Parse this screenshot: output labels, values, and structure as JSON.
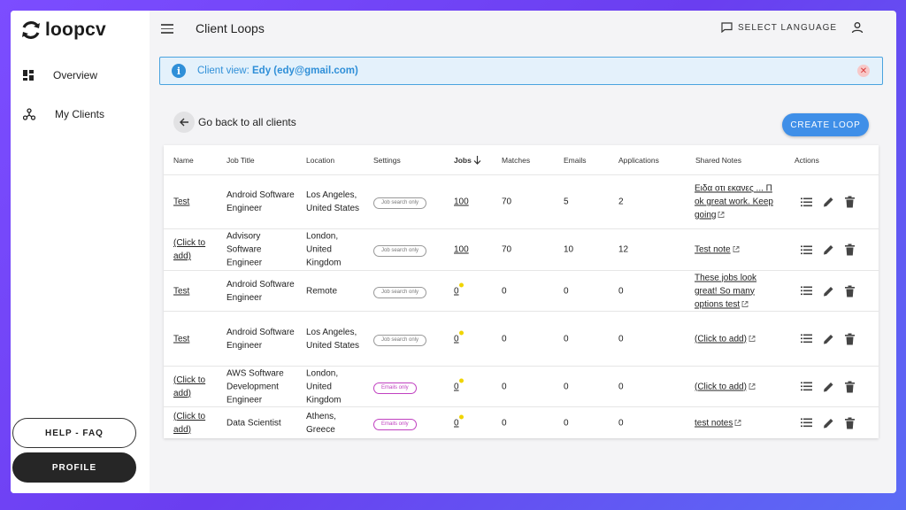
{
  "app": {
    "logo_text": "loopcv"
  },
  "sidebar": {
    "items": [
      {
        "label": "Overview",
        "icon": "dashboard-icon"
      },
      {
        "label": "My Clients",
        "icon": "hub-icon"
      }
    ],
    "help_label": "HELP - FAQ",
    "profile_label": "PROFILE"
  },
  "header": {
    "title": "Client Loops",
    "language_label": "SELECT LANGUAGE"
  },
  "banner": {
    "prefix": "Client view:",
    "client": "Edy (edy@gmail.com)"
  },
  "back_label": "Go back to all clients",
  "create_label": "CREATE LOOP",
  "table": {
    "headers": {
      "name": "Name",
      "job_title": "Job Title",
      "location": "Location",
      "settings": "Settings",
      "jobs": "Jobs",
      "matches": "Matches",
      "emails": "Emails",
      "applications": "Applications",
      "shared_notes": "Shared Notes",
      "actions": "Actions"
    },
    "rows": [
      {
        "name": "Test",
        "job_title": "Android Software Engineer",
        "location": "Los Angeles, United States",
        "settings": "Job search only",
        "jobs": "100",
        "matches": "70",
        "emails": "5",
        "applications": "2",
        "notes": "Ειδα οτι εκανες ... Π ok great work. Keep going"
      },
      {
        "name": "(Click to add)",
        "job_title": "Advisory Software Engineer",
        "location": "London, United Kingdom",
        "settings": "Job search only",
        "jobs": "100",
        "matches": "70",
        "emails": "10",
        "applications": "12",
        "notes": "Test note"
      },
      {
        "name": "Test",
        "job_title": "Android Software Engineer",
        "location": "Remote",
        "settings": "Job search only",
        "jobs": "0",
        "matches": "0",
        "emails": "0",
        "applications": "0",
        "notes": "These jobs look great! So many options test"
      },
      {
        "name": "Test",
        "job_title": "Android Software Engineer",
        "location": "Los Angeles, United States",
        "settings": "Job search only",
        "jobs": "0",
        "matches": "0",
        "emails": "0",
        "applications": "0",
        "notes": "(Click to add)"
      },
      {
        "name": "(Click to add)",
        "job_title": "AWS Software Development Engineer",
        "location": "London, United Kingdom",
        "settings": "Emails only",
        "jobs": "0",
        "matches": "0",
        "emails": "0",
        "applications": "0",
        "notes": "(Click to add)"
      },
      {
        "name": "(Click to add)",
        "job_title": "Data Scientist",
        "location": "Athens, Greece",
        "settings": "Emails only",
        "jobs": "0",
        "matches": "0",
        "emails": "0",
        "applications": "0",
        "notes": "test notes"
      }
    ]
  },
  "colors": {
    "accent": "#3f8fe8",
    "info": "#2f8fd8",
    "email_tag": "#c040c0",
    "pending_dot": "#f0d400"
  }
}
